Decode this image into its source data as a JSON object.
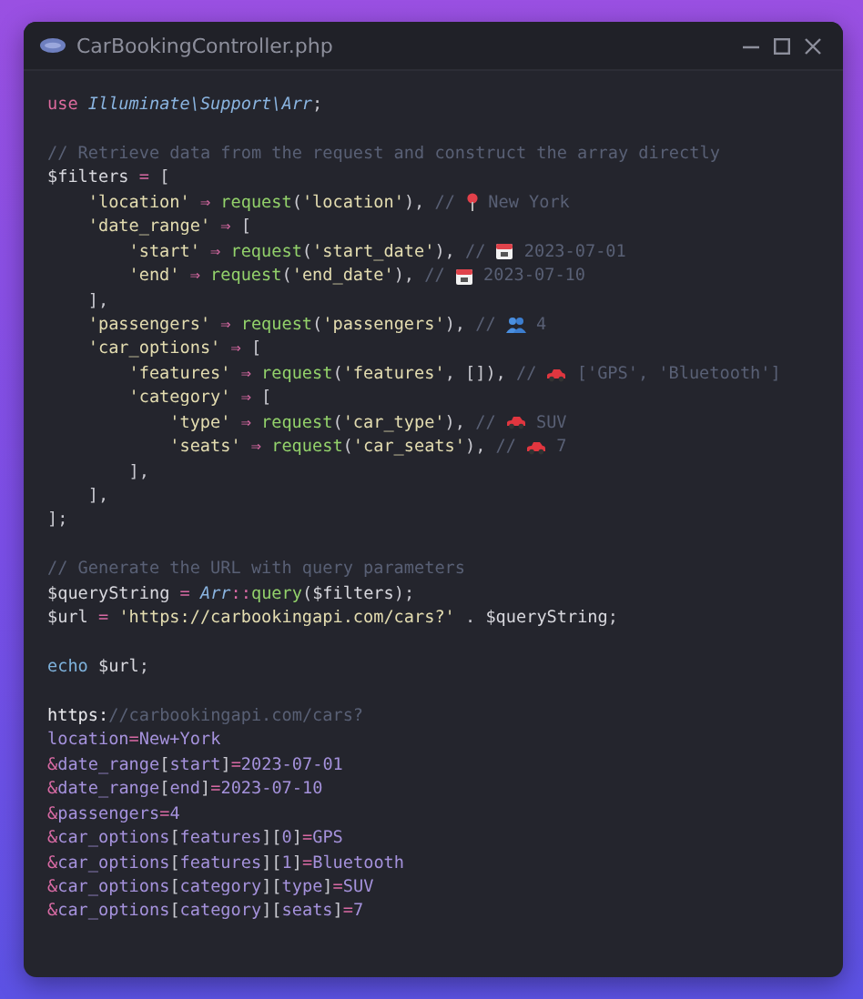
{
  "window": {
    "title": "CarBookingController.php"
  },
  "code_blocks": [
    [
      {
        "tokens": [
          {
            "kind": "kw",
            "text": "use "
          },
          {
            "kind": "cls",
            "text": "Illuminate\\Support\\Arr"
          },
          {
            "kind": "punc",
            "text": ";"
          }
        ]
      }
    ],
    [
      {
        "tokens": [
          {
            "kind": "cmt",
            "text": "// Retrieve data from the request and construct the array directly"
          }
        ]
      },
      {
        "tokens": [
          {
            "kind": "var",
            "text": "$filters"
          },
          {
            "kind": "op",
            "text": " = "
          },
          {
            "kind": "punc",
            "text": "["
          }
        ],
        "children": [
          {
            "tokens": [
              {
                "kind": "str",
                "text": "'location'"
              },
              {
                "kind": "op",
                "text": " ⇒ "
              },
              {
                "kind": "fn",
                "text": "request"
              },
              {
                "kind": "punc",
                "text": "("
              },
              {
                "kind": "str",
                "text": "'location'"
              },
              {
                "kind": "punc",
                "text": "),"
              },
              {
                "kind": "cmt",
                "text": " // "
              },
              {
                "kind": "pin"
              },
              {
                "kind": "cmt",
                "text": " New York"
              }
            ]
          },
          {
            "tokens": [
              {
                "kind": "str",
                "text": "'date_range'"
              },
              {
                "kind": "op",
                "text": " ⇒ "
              },
              {
                "kind": "punc",
                "text": "["
              }
            ],
            "children": [
              {
                "tokens": [
                  {
                    "kind": "str",
                    "text": "'start'"
                  },
                  {
                    "kind": "op",
                    "text": " ⇒ "
                  },
                  {
                    "kind": "fn",
                    "text": "request"
                  },
                  {
                    "kind": "punc",
                    "text": "("
                  },
                  {
                    "kind": "str",
                    "text": "'start_date'"
                  },
                  {
                    "kind": "punc",
                    "text": "),"
                  },
                  {
                    "kind": "cmt",
                    "text": " // "
                  },
                  {
                    "kind": "calendar"
                  },
                  {
                    "kind": "cmt",
                    "text": " 2023-07-01"
                  }
                ]
              },
              {
                "tokens": [
                  {
                    "kind": "str",
                    "text": "'end'"
                  },
                  {
                    "kind": "op",
                    "text": " ⇒ "
                  },
                  {
                    "kind": "fn",
                    "text": "request"
                  },
                  {
                    "kind": "punc",
                    "text": "("
                  },
                  {
                    "kind": "str",
                    "text": "'end_date'"
                  },
                  {
                    "kind": "punc",
                    "text": "),"
                  },
                  {
                    "kind": "cmt",
                    "text": " // "
                  },
                  {
                    "kind": "calendar"
                  },
                  {
                    "kind": "cmt",
                    "text": " 2023-07-10"
                  }
                ]
              }
            ]
          },
          {
            "tokens": [
              {
                "kind": "punc",
                "text": "],"
              }
            ]
          },
          {
            "tokens": [
              {
                "kind": "str",
                "text": "'passengers'"
              },
              {
                "kind": "op",
                "text": " ⇒ "
              },
              {
                "kind": "fn",
                "text": "request"
              },
              {
                "kind": "punc",
                "text": "("
              },
              {
                "kind": "str",
                "text": "'passengers'"
              },
              {
                "kind": "punc",
                "text": "),"
              },
              {
                "kind": "cmt",
                "text": " // "
              },
              {
                "kind": "people"
              },
              {
                "kind": "cmt",
                "text": " 4"
              }
            ]
          },
          {
            "tokens": [
              {
                "kind": "str",
                "text": "'car_options'"
              },
              {
                "kind": "op",
                "text": " ⇒ "
              },
              {
                "kind": "punc",
                "text": "["
              }
            ],
            "children": [
              {
                "tokens": [
                  {
                    "kind": "str",
                    "text": "'features'"
                  },
                  {
                    "kind": "op",
                    "text": " ⇒ "
                  },
                  {
                    "kind": "fn",
                    "text": "request"
                  },
                  {
                    "kind": "punc",
                    "text": "("
                  },
                  {
                    "kind": "str",
                    "text": "'features'"
                  },
                  {
                    "kind": "punc",
                    "text": ", []),"
                  },
                  {
                    "kind": "cmt",
                    "text": " // "
                  },
                  {
                    "kind": "car"
                  },
                  {
                    "kind": "cmt",
                    "text": " ['GPS', 'Bluetooth']"
                  }
                ]
              },
              {
                "tokens": [
                  {
                    "kind": "str",
                    "text": "'category'"
                  },
                  {
                    "kind": "op",
                    "text": " ⇒ "
                  },
                  {
                    "kind": "punc",
                    "text": "["
                  }
                ],
                "children": [
                  {
                    "tokens": [
                      {
                        "kind": "str",
                        "text": "'type'"
                      },
                      {
                        "kind": "op",
                        "text": " ⇒ "
                      },
                      {
                        "kind": "fn",
                        "text": "request"
                      },
                      {
                        "kind": "punc",
                        "text": "("
                      },
                      {
                        "kind": "str",
                        "text": "'car_type'"
                      },
                      {
                        "kind": "punc",
                        "text": "),"
                      },
                      {
                        "kind": "cmt",
                        "text": " // "
                      },
                      {
                        "kind": "car"
                      },
                      {
                        "kind": "cmt",
                        "text": " SUV"
                      }
                    ]
                  },
                  {
                    "tokens": [
                      {
                        "kind": "str",
                        "text": "'seats'"
                      },
                      {
                        "kind": "op",
                        "text": " ⇒ "
                      },
                      {
                        "kind": "fn",
                        "text": "request"
                      },
                      {
                        "kind": "punc",
                        "text": "("
                      },
                      {
                        "kind": "str",
                        "text": "'car_seats'"
                      },
                      {
                        "kind": "punc",
                        "text": "),"
                      },
                      {
                        "kind": "cmt",
                        "text": " // "
                      },
                      {
                        "kind": "car"
                      },
                      {
                        "kind": "cmt",
                        "text": " 7"
                      }
                    ]
                  }
                ]
              },
              {
                "tokens": [
                  {
                    "kind": "punc",
                    "text": "],"
                  }
                ]
              }
            ]
          },
          {
            "tokens": [
              {
                "kind": "punc",
                "text": "],"
              }
            ]
          }
        ]
      },
      {
        "tokens": [
          {
            "kind": "punc",
            "text": "];"
          }
        ]
      }
    ],
    [
      {
        "tokens": [
          {
            "kind": "cmt",
            "text": "// Generate the URL with query parameters"
          }
        ]
      },
      {
        "tokens": [
          {
            "kind": "var",
            "text": "$queryString"
          },
          {
            "kind": "op",
            "text": " = "
          },
          {
            "kind": "cls",
            "text": "Arr"
          },
          {
            "kind": "op",
            "text": "::"
          },
          {
            "kind": "fn",
            "text": "query"
          },
          {
            "kind": "punc",
            "text": "("
          },
          {
            "kind": "var",
            "text": "$filters"
          },
          {
            "kind": "punc",
            "text": ");"
          }
        ]
      },
      {
        "tokens": [
          {
            "kind": "var",
            "text": "$url"
          },
          {
            "kind": "op",
            "text": " = "
          },
          {
            "kind": "str",
            "text": "'https://carbookingapi.com/cars?'"
          },
          {
            "kind": "punc",
            "text": " . "
          },
          {
            "kind": "var",
            "text": "$queryString"
          },
          {
            "kind": "punc",
            "text": ";"
          }
        ]
      }
    ],
    [
      {
        "tokens": [
          {
            "kind": "builtin",
            "text": "echo "
          },
          {
            "kind": "var",
            "text": "$url"
          },
          {
            "kind": "punc",
            "text": ";"
          }
        ]
      }
    ],
    [
      {
        "tokens": [
          {
            "kind": "plain",
            "text": "https:"
          },
          {
            "kind": "cmt",
            "text": "//carbookingapi.com/cars?"
          }
        ]
      },
      {
        "tokens": [
          {
            "kind": "q",
            "text": "location"
          },
          {
            "kind": "op",
            "text": "="
          },
          {
            "kind": "q",
            "text": "New+York"
          }
        ]
      },
      {
        "tokens": [
          {
            "kind": "op",
            "text": "&"
          },
          {
            "kind": "q",
            "text": "date_range"
          },
          {
            "kind": "punc",
            "text": "["
          },
          {
            "kind": "q",
            "text": "start"
          },
          {
            "kind": "punc",
            "text": "]"
          },
          {
            "kind": "op",
            "text": "="
          },
          {
            "kind": "q",
            "text": "2023-07-01"
          }
        ]
      },
      {
        "tokens": [
          {
            "kind": "op",
            "text": "&"
          },
          {
            "kind": "q",
            "text": "date_range"
          },
          {
            "kind": "punc",
            "text": "["
          },
          {
            "kind": "q",
            "text": "end"
          },
          {
            "kind": "punc",
            "text": "]"
          },
          {
            "kind": "op",
            "text": "="
          },
          {
            "kind": "q",
            "text": "2023-07-10"
          }
        ]
      },
      {
        "tokens": [
          {
            "kind": "op",
            "text": "&"
          },
          {
            "kind": "q",
            "text": "passengers"
          },
          {
            "kind": "op",
            "text": "="
          },
          {
            "kind": "q",
            "text": "4"
          }
        ]
      },
      {
        "tokens": [
          {
            "kind": "op",
            "text": "&"
          },
          {
            "kind": "q",
            "text": "car_options"
          },
          {
            "kind": "punc",
            "text": "["
          },
          {
            "kind": "q",
            "text": "features"
          },
          {
            "kind": "punc",
            "text": "]["
          },
          {
            "kind": "q",
            "text": "0"
          },
          {
            "kind": "punc",
            "text": "]"
          },
          {
            "kind": "op",
            "text": "="
          },
          {
            "kind": "q",
            "text": "GPS"
          }
        ]
      },
      {
        "tokens": [
          {
            "kind": "op",
            "text": "&"
          },
          {
            "kind": "q",
            "text": "car_options"
          },
          {
            "kind": "punc",
            "text": "["
          },
          {
            "kind": "q",
            "text": "features"
          },
          {
            "kind": "punc",
            "text": "]["
          },
          {
            "kind": "q",
            "text": "1"
          },
          {
            "kind": "punc",
            "text": "]"
          },
          {
            "kind": "op",
            "text": "="
          },
          {
            "kind": "q",
            "text": "Bluetooth"
          }
        ]
      },
      {
        "tokens": [
          {
            "kind": "op",
            "text": "&"
          },
          {
            "kind": "q",
            "text": "car_options"
          },
          {
            "kind": "punc",
            "text": "["
          },
          {
            "kind": "q",
            "text": "category"
          },
          {
            "kind": "punc",
            "text": "]["
          },
          {
            "kind": "q",
            "text": "type"
          },
          {
            "kind": "punc",
            "text": "]"
          },
          {
            "kind": "op",
            "text": "="
          },
          {
            "kind": "q",
            "text": "SUV"
          }
        ]
      },
      {
        "tokens": [
          {
            "kind": "op",
            "text": "&"
          },
          {
            "kind": "q",
            "text": "car_options"
          },
          {
            "kind": "punc",
            "text": "["
          },
          {
            "kind": "q",
            "text": "category"
          },
          {
            "kind": "punc",
            "text": "]["
          },
          {
            "kind": "q",
            "text": "seats"
          },
          {
            "kind": "punc",
            "text": "]"
          },
          {
            "kind": "op",
            "text": "="
          },
          {
            "kind": "q",
            "text": "7"
          }
        ]
      }
    ]
  ]
}
